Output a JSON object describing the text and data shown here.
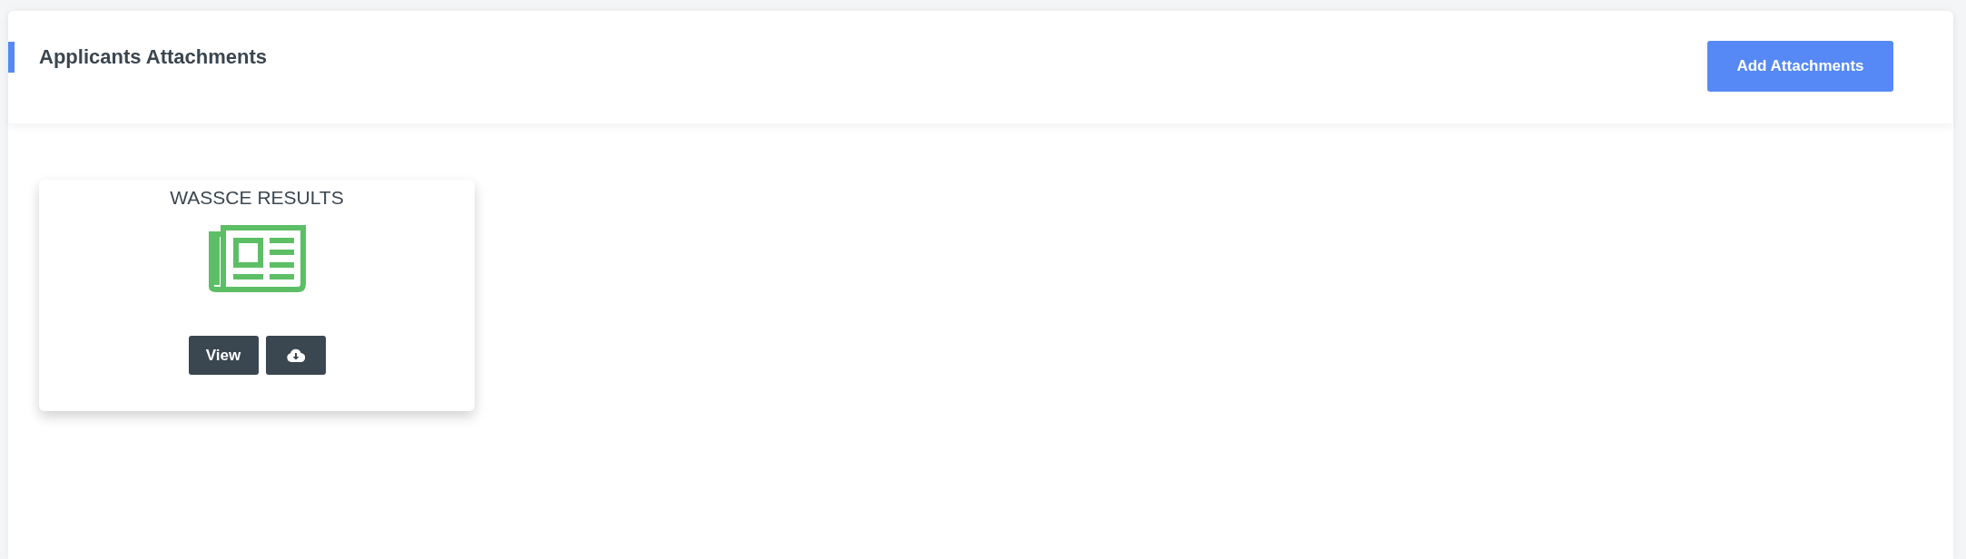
{
  "header": {
    "title": "Applicants Attachments",
    "button": "Add Attachments"
  },
  "attachments": [
    {
      "title": "WASSCE RESULTS",
      "view_button": "View"
    }
  ]
}
